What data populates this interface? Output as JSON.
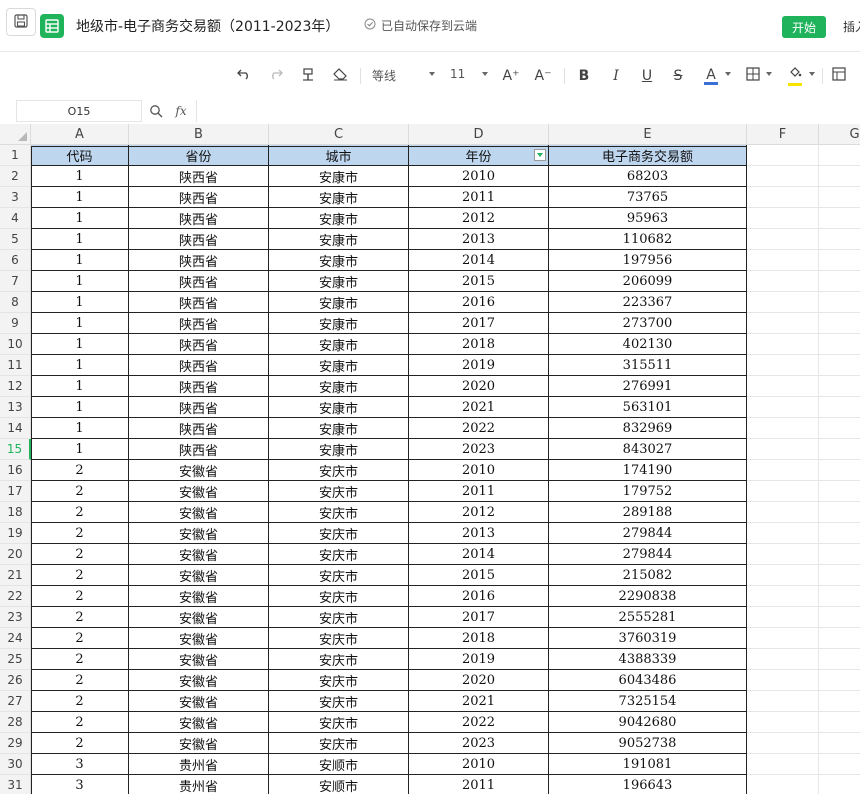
{
  "titlebar": {
    "doc_title": "地级市-电子商务交易额（2011-2023年）",
    "autosave_text": "已自动保存到云端",
    "start_label": "开始",
    "insert_label": "插入",
    "accent_color": "#1fb35b"
  },
  "toolbar": {
    "font_name": "等线",
    "font_size": "11",
    "bold_label": "B",
    "italic_label": "I",
    "underline_label": "U",
    "strike_label": "S",
    "font_color_label": "A",
    "increase_font_label": "A⁺",
    "decrease_font_label": "A⁻",
    "font_color": "#3a6fd8",
    "fill_color": "#f5e400"
  },
  "formula_bar": {
    "cell_ref": "O15",
    "fx_label": "fx",
    "formula_value": ""
  },
  "sheet": {
    "columns": [
      "A",
      "B",
      "C",
      "D",
      "E",
      "F",
      "G"
    ],
    "active_row": 15,
    "header_row": [
      "代码",
      "省份",
      "城市",
      "年份",
      "电子商务交易额"
    ],
    "rows": [
      [
        "1",
        "陕西省",
        "安康市",
        "2010",
        "68203"
      ],
      [
        "1",
        "陕西省",
        "安康市",
        "2011",
        "73765"
      ],
      [
        "1",
        "陕西省",
        "安康市",
        "2012",
        "95963"
      ],
      [
        "1",
        "陕西省",
        "安康市",
        "2013",
        "110682"
      ],
      [
        "1",
        "陕西省",
        "安康市",
        "2014",
        "197956"
      ],
      [
        "1",
        "陕西省",
        "安康市",
        "2015",
        "206099"
      ],
      [
        "1",
        "陕西省",
        "安康市",
        "2016",
        "223367"
      ],
      [
        "1",
        "陕西省",
        "安康市",
        "2017",
        "273700"
      ],
      [
        "1",
        "陕西省",
        "安康市",
        "2018",
        "402130"
      ],
      [
        "1",
        "陕西省",
        "安康市",
        "2019",
        "315511"
      ],
      [
        "1",
        "陕西省",
        "安康市",
        "2020",
        "276991"
      ],
      [
        "1",
        "陕西省",
        "安康市",
        "2021",
        "563101"
      ],
      [
        "1",
        "陕西省",
        "安康市",
        "2022",
        "832969"
      ],
      [
        "1",
        "陕西省",
        "安康市",
        "2023",
        "843027"
      ],
      [
        "2",
        "安徽省",
        "安庆市",
        "2010",
        "174190"
      ],
      [
        "2",
        "安徽省",
        "安庆市",
        "2011",
        "179752"
      ],
      [
        "2",
        "安徽省",
        "安庆市",
        "2012",
        "289188"
      ],
      [
        "2",
        "安徽省",
        "安庆市",
        "2013",
        "279844"
      ],
      [
        "2",
        "安徽省",
        "安庆市",
        "2014",
        "279844"
      ],
      [
        "2",
        "安徽省",
        "安庆市",
        "2015",
        "215082"
      ],
      [
        "2",
        "安徽省",
        "安庆市",
        "2016",
        "2290838"
      ],
      [
        "2",
        "安徽省",
        "安庆市",
        "2017",
        "2555281"
      ],
      [
        "2",
        "安徽省",
        "安庆市",
        "2018",
        "3760319"
      ],
      [
        "2",
        "安徽省",
        "安庆市",
        "2019",
        "4388339"
      ],
      [
        "2",
        "安徽省",
        "安庆市",
        "2020",
        "6043486"
      ],
      [
        "2",
        "安徽省",
        "安庆市",
        "2021",
        "7325154"
      ],
      [
        "2",
        "安徽省",
        "安庆市",
        "2022",
        "9042680"
      ],
      [
        "2",
        "安徽省",
        "安庆市",
        "2023",
        "9052738"
      ],
      [
        "3",
        "贵州省",
        "安顺市",
        "2010",
        "191081"
      ],
      [
        "3",
        "贵州省",
        "安顺市",
        "2011",
        "196643"
      ]
    ]
  }
}
